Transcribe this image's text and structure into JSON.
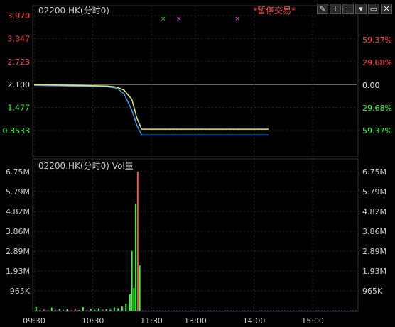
{
  "colors": {
    "up": "#ff4d4d",
    "down": "#39ff39",
    "neutral": "#e6e6e6",
    "price_line": "#e8e35a",
    "avg_line": "#3aa0ff",
    "grid": "#2a2a2a",
    "title": "#c9c9c9",
    "suspend": "#ff5050"
  },
  "price_panel": {
    "title": "02200.HK(分时0)",
    "status": "*暂停交易*",
    "left_ticks": [
      {
        "label": "3.970",
        "color": "#ff4d4d"
      },
      {
        "label": "3.347",
        "color": "#ff4d4d"
      },
      {
        "label": "2.723",
        "color": "#ff4d4d"
      },
      {
        "label": "2.100",
        "color": "#e6e6e6"
      },
      {
        "label": "1.477",
        "color": "#39ff39"
      },
      {
        "label": "0.8533",
        "color": "#39ff39"
      }
    ],
    "right_ticks": [
      {
        "label": "59.37%",
        "color": "#ff4d4d"
      },
      {
        "label": "29.68%",
        "color": "#ff4d4d"
      },
      {
        "label": "0.00",
        "color": "#e6e6e6"
      },
      {
        "label": "29.68%",
        "color": "#39ff39"
      },
      {
        "label": "59.37%",
        "color": "#39ff39"
      }
    ]
  },
  "volume_panel": {
    "title": "02200.HK(分时0) Vol量",
    "ticks": [
      "6.75M",
      "5.79M",
      "4.82M",
      "3.86M",
      "2.89M",
      "1.93M",
      "965K"
    ]
  },
  "time_axis": [
    "09:30",
    "10:30",
    "11:30",
    "13:00",
    "14:00",
    "15:00"
  ],
  "toolbar": [
    {
      "name": "edit-icon",
      "glyph": "✎"
    },
    {
      "name": "plus-icon",
      "glyph": "+"
    },
    {
      "name": "minus-icon",
      "glyph": "−"
    },
    {
      "name": "menu-down-icon",
      "glyph": "▾"
    },
    {
      "name": "maximize-icon",
      "glyph": "▭"
    },
    {
      "name": "close-icon",
      "glyph": "✕"
    }
  ],
  "chart_data": {
    "type": "line",
    "price_series": {
      "name": "",
      "points": [
        [
          0,
          2.1
        ],
        [
          20,
          2.09
        ],
        [
          40,
          2.08
        ],
        [
          60,
          2.07
        ],
        [
          75,
          2.06
        ],
        [
          85,
          2.03
        ],
        [
          92,
          1.95
        ],
        [
          100,
          1.7
        ],
        [
          105,
          1.2
        ],
        [
          110,
          0.89
        ],
        [
          180,
          0.89
        ],
        [
          240,
          0.89
        ]
      ]
    },
    "avg_series": {
      "name": "",
      "points": [
        [
          0,
          2.08
        ],
        [
          20,
          2.07
        ],
        [
          40,
          2.06
        ],
        [
          60,
          2.05
        ],
        [
          75,
          2.04
        ],
        [
          85,
          2.0
        ],
        [
          92,
          1.85
        ],
        [
          100,
          1.4
        ],
        [
          105,
          1.0
        ],
        [
          110,
          0.73
        ],
        [
          180,
          0.73
        ],
        [
          240,
          0.73
        ]
      ]
    },
    "volume": {
      "minutes": [
        2,
        6,
        10,
        14,
        18,
        22,
        26,
        30,
        34,
        38,
        42,
        46,
        50,
        54,
        58,
        62,
        66,
        70,
        74,
        78,
        82,
        86,
        90,
        94,
        98,
        100,
        102,
        104,
        106,
        108
      ],
      "values": [
        180000,
        30000,
        60000,
        20000,
        150000,
        40000,
        90000,
        30000,
        70000,
        20000,
        110000,
        30000,
        170000,
        25000,
        90000,
        40000,
        120000,
        60000,
        80000,
        50000,
        160000,
        120000,
        200000,
        350000,
        800000,
        2900000,
        1100000,
        5200000,
        6750000,
        2200000
      ],
      "colors": [
        "#39ff39",
        "#39ff39",
        "#ff4d4d",
        "#39ff39",
        "#39ff39",
        "#ff4d4d",
        "#39ff39",
        "#39ff39",
        "#e6e6e6",
        "#39ff39",
        "#ff4d4d",
        "#39ff39",
        "#39ff39",
        "#ff4d4d",
        "#39ff39",
        "#39ff39",
        "#39ff39",
        "#ff4d4d",
        "#39ff39",
        "#39ff39",
        "#39ff39",
        "#39ff39",
        "#39ff39",
        "#39ff39",
        "#39ff39",
        "#39ff39",
        "#39ff39",
        "#39ff39",
        "#ff4d4d",
        "#39ff39"
      ]
    },
    "price_range": [
      0.8533,
      3.97
    ],
    "volume_range": [
      0,
      6750000
    ],
    "x_range": [
      0,
      330
    ],
    "grid": true
  }
}
